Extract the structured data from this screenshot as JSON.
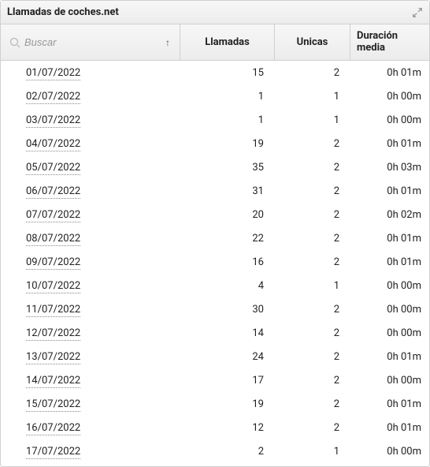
{
  "title": "Llamadas de coches.net",
  "search": {
    "placeholder": "Buscar"
  },
  "columns": {
    "llamadas": "Llamadas",
    "unicas": "Unicas",
    "duracion": "Duración media"
  },
  "sort_indicator": "↑",
  "rows": [
    {
      "date": "01/07/2022",
      "llamadas": "15",
      "unicas": "2",
      "duracion": "0h 01m"
    },
    {
      "date": "02/07/2022",
      "llamadas": "1",
      "unicas": "1",
      "duracion": "0h 00m"
    },
    {
      "date": "03/07/2022",
      "llamadas": "1",
      "unicas": "1",
      "duracion": "0h 00m"
    },
    {
      "date": "04/07/2022",
      "llamadas": "19",
      "unicas": "2",
      "duracion": "0h 01m"
    },
    {
      "date": "05/07/2022",
      "llamadas": "35",
      "unicas": "2",
      "duracion": "0h 03m"
    },
    {
      "date": "06/07/2022",
      "llamadas": "31",
      "unicas": "2",
      "duracion": "0h 01m"
    },
    {
      "date": "07/07/2022",
      "llamadas": "20",
      "unicas": "2",
      "duracion": "0h 02m"
    },
    {
      "date": "08/07/2022",
      "llamadas": "22",
      "unicas": "2",
      "duracion": "0h 01m"
    },
    {
      "date": "09/07/2022",
      "llamadas": "16",
      "unicas": "2",
      "duracion": "0h 01m"
    },
    {
      "date": "10/07/2022",
      "llamadas": "4",
      "unicas": "1",
      "duracion": "0h 00m"
    },
    {
      "date": "11/07/2022",
      "llamadas": "30",
      "unicas": "2",
      "duracion": "0h 00m"
    },
    {
      "date": "12/07/2022",
      "llamadas": "14",
      "unicas": "2",
      "duracion": "0h 00m"
    },
    {
      "date": "13/07/2022",
      "llamadas": "24",
      "unicas": "2",
      "duracion": "0h 01m"
    },
    {
      "date": "14/07/2022",
      "llamadas": "17",
      "unicas": "2",
      "duracion": "0h 00m"
    },
    {
      "date": "15/07/2022",
      "llamadas": "19",
      "unicas": "2",
      "duracion": "0h 01m"
    },
    {
      "date": "16/07/2022",
      "llamadas": "12",
      "unicas": "2",
      "duracion": "0h 01m"
    },
    {
      "date": "17/07/2022",
      "llamadas": "2",
      "unicas": "1",
      "duracion": "0h 00m"
    }
  ]
}
